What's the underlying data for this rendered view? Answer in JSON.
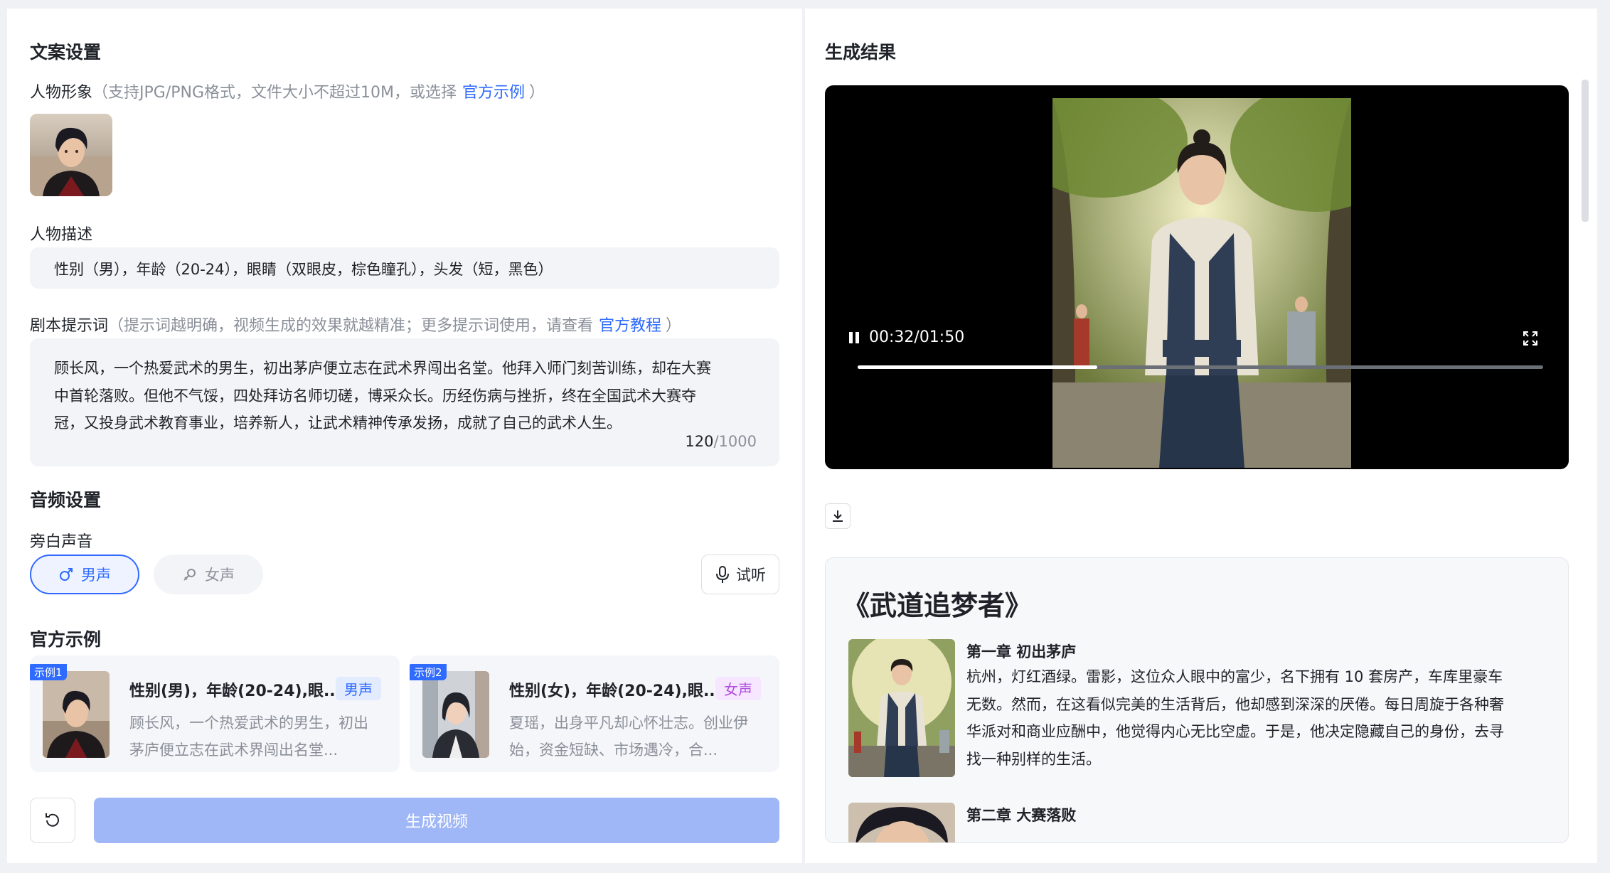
{
  "left": {
    "section_copy": "文案设置",
    "avatar": {
      "label": "人物形象",
      "hint": "（支持JPG/PNG格式，文件大小不超过10M，或选择",
      "link": "官方示例",
      "hint_end": "）"
    },
    "desc": {
      "label": "人物描述",
      "value": "性别（男），年龄（20-24），眼睛（双眼皮，棕色瞳孔），头发（短，黑色）"
    },
    "prompt": {
      "label": "剧本提示词",
      "hint": "（提示词越明确，视频生成的效果就越精准；更多提示词使用，请查看",
      "link": "官方教程",
      "hint_end": "）",
      "line1": "顾长风，一个热爱武术的男生，初出茅庐便立志在武术界闯出名堂。他拜入师门刻苦训练，却在大赛",
      "line2": "中首轮落败。但他不气馁，四处拜访名师切磋，博采众长。历经伤病与挫折，终在全国武术大赛夺",
      "line3": "冠，又投身武术教育事业，培养新人，让武术精神传承发扬，成就了自己的武术人生。",
      "count": "120",
      "max": "/1000"
    },
    "section_audio": "音频设置",
    "narration_label": "旁白声音",
    "voice_male": "男声",
    "voice_female": "女声",
    "listen": "试听",
    "section_examples": "官方示例",
    "examples": [
      {
        "tag": "示例1",
        "title": "性别(男)，年龄(20-24),眼...",
        "badge": "男声",
        "line1": "顾长风，一个热爱武术的男生，初出",
        "line2": "茅庐便立志在武术界闯出名堂..."
      },
      {
        "tag": "示例2",
        "title": "性别(女)，年龄(20-24),眼...",
        "badge": "女声",
        "line1": "夏瑶，出身平凡却心怀壮志。创业伊",
        "line2": "始，资金短缺、市场遇冷，合..."
      }
    ],
    "generate": "生成视频"
  },
  "right": {
    "section_result": "生成结果",
    "video": {
      "time": "00:32/01:50",
      "progress": 0.35
    },
    "story": {
      "title": "《武道追梦者》",
      "ch1_title": "第一章 初出茅庐",
      "ch1_line1": "杭州，灯红酒绿。雷影，这位众人眼中的富少，名下拥有 10 套房产，车库里豪车",
      "ch1_line2": "无数。然而，在这看似完美的生活背后，他却感到深深的厌倦。每日周旋于各种奢",
      "ch1_line3": "华派对和商业应酬中，他觉得内心无比空虚。于是，他决定隐藏自己的身份，去寻",
      "ch1_line4": "找一种别样的生活。",
      "ch2_title": "第二章 大赛落败"
    }
  },
  "colors": {
    "accent": "#2f6bff",
    "female_accent": "#b04ee0",
    "generate_disabled": "#9fb7f7"
  }
}
